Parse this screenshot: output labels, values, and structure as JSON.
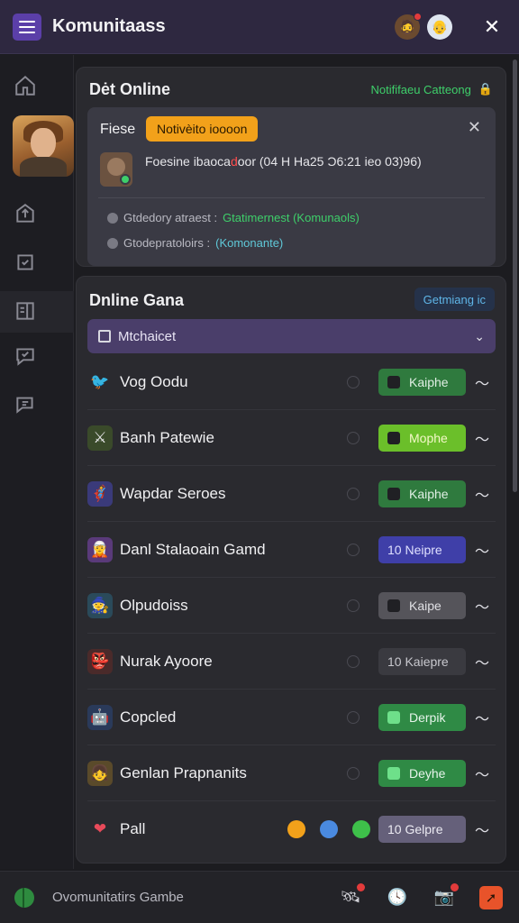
{
  "app": {
    "title": "Komunitaass"
  },
  "card1": {
    "title": "Dėt Online",
    "link": "Notififaeu Catteong",
    "notice": {
      "label": "Fiese",
      "pill": "Notivèito ioooon",
      "text_pre": "Foesine ibaoca",
      "text_hl": "d",
      "text_post": "oor (​04 H Ha25 Ɔ6:21 ieo 03)96)",
      "row1_pre": "Gtdedory atraest : ",
      "row1_hl": "Gtatimernest (Komunaols)",
      "row2_pre": "Gtodepratoloirs : ",
      "row2_hl": "(Komonante)"
    }
  },
  "card2": {
    "title": "Dnline Gana",
    "link": "Getmiang ​ic",
    "dropdown": "Mtchaicet",
    "games": [
      {
        "name": "Vog Oodu",
        "status": "Kaiphe",
        "icon": "bird-icon",
        "color": "green"
      },
      {
        "name": "Banh Patewie",
        "status": "Mophe",
        "icon": "swords-icon",
        "color": "lime"
      },
      {
        "name": "Wapdar Seroes",
        "status": "Kaiphe",
        "icon": "hero-icon",
        "color": "green"
      },
      {
        "name": "Danl Stalaoain Gamd",
        "status": "10 Neipre",
        "icon": "fantasy-icon",
        "color": "blue"
      },
      {
        "name": "Olpudoiss",
        "status": "Kaipe",
        "icon": "mage-icon",
        "color": "gray"
      },
      {
        "name": "Nurak Ayoore",
        "status": "10 Kaiepre",
        "icon": "warrior-icon",
        "color": "dark"
      },
      {
        "name": "Copcled",
        "status": "Derpik",
        "icon": "robot-icon",
        "color": "green2"
      },
      {
        "name": "Genlan Prapnanits",
        "status": "Deyhe",
        "icon": "girl-icon",
        "color": "green2"
      },
      {
        "name": "Pall",
        "status": "10 Gelpre",
        "icon": "heart-icon",
        "color": "purple"
      }
    ]
  },
  "bottom": {
    "label": "Ovomunitatirs Gambe"
  }
}
